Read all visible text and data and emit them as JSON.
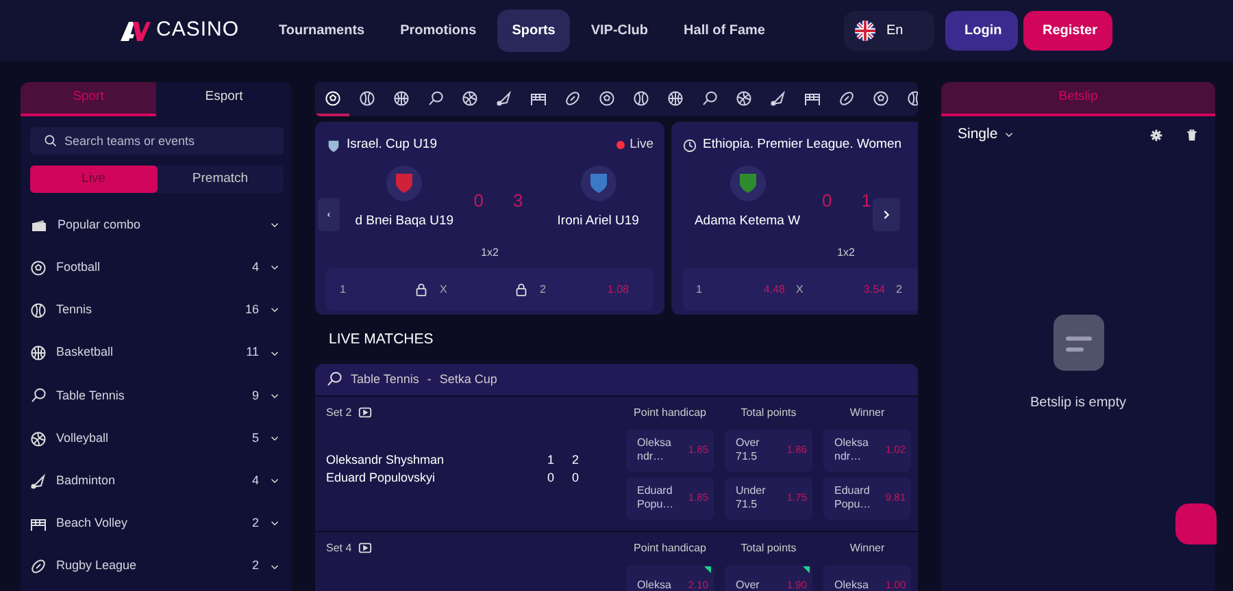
{
  "header": {
    "brand": "CASINO",
    "nav": [
      {
        "label": "Tournaments",
        "selected": false
      },
      {
        "label": "Promotions",
        "selected": false
      },
      {
        "label": "Sports",
        "selected": true
      },
      {
        "label": "VIP-Club",
        "selected": false
      },
      {
        "label": "Hall of Fame",
        "selected": false
      }
    ],
    "language": "En",
    "login": "Login",
    "register": "Register"
  },
  "sidebar": {
    "tabs": [
      {
        "label": "Sport",
        "selected": true
      },
      {
        "label": "Esport",
        "selected": false
      }
    ],
    "search": {
      "placeholder": "Search teams or events"
    },
    "modes": [
      {
        "label": "Live",
        "selected": true
      },
      {
        "label": "Prematch",
        "selected": false
      }
    ],
    "items": [
      {
        "name": "Popular combo"
      },
      {
        "name": "Football",
        "count": "4"
      },
      {
        "name": "Tennis",
        "count": "16"
      },
      {
        "name": "Basketball",
        "count": "11"
      },
      {
        "name": "Table Tennis",
        "count": "9"
      },
      {
        "name": "Volleyball",
        "count": "5"
      },
      {
        "name": "Badminton",
        "count": "4"
      },
      {
        "name": "Beach Volley",
        "count": "2"
      },
      {
        "name": "Rugby League",
        "count": "2"
      }
    ]
  },
  "sport_tabs": [
    {
      "selected": true
    },
    {
      "selected": false
    },
    {
      "selected": false
    },
    {
      "selected": false
    },
    {
      "selected": false
    },
    {
      "selected": false
    },
    {
      "selected": false
    },
    {
      "selected": false
    },
    {
      "selected": false
    },
    {
      "selected": false
    },
    {
      "selected": false
    },
    {
      "selected": false
    },
    {
      "selected": false
    },
    {
      "selected": false
    },
    {
      "selected": false
    },
    {
      "selected": false
    },
    {
      "selected": false
    },
    {
      "selected": false
    }
  ],
  "featured": [
    {
      "league": "Israel. Cup U19",
      "live": "Live",
      "team_1": "d Bnei Baqa U19",
      "team_2": "Ironi Ariel U19",
      "score_1": "0",
      "score_2": "3",
      "market": "1x2",
      "odds": [
        {
          "label": "1",
          "locked": true
        },
        {
          "label": "X",
          "locked": true
        },
        {
          "label": "2",
          "value": "1.08",
          "locked": false
        }
      ]
    },
    {
      "league": "Ethiopia. Premier League. Women",
      "team_1": "Adama Ketema W",
      "score_1": "0",
      "score_2": "1",
      "market": "1x2",
      "odds": [
        {
          "label": "1",
          "value": "4.48",
          "locked": false
        },
        {
          "label": "X",
          "value": "3.54",
          "locked": false
        },
        {
          "label": "2",
          "locked": false
        }
      ]
    }
  ],
  "live_matches": {
    "title": "LIVE MATCHES",
    "group": "Table Tennis",
    "separator": "-",
    "tournament": "Setka Cup",
    "matches": [
      {
        "period": "Set 2",
        "players": [
          "Oleksandr Shyshman",
          "Eduard Populovskyi"
        ],
        "scores": [
          [
            "1",
            "2"
          ],
          [
            "0",
            "0"
          ]
        ],
        "markets": [
          "Point handicap",
          "Total points",
          "Winner"
        ],
        "rows": [
          [
            {
              "label": "Oleksa ndr…",
              "value": "1.85",
              "rising": false
            },
            {
              "label": "Over 71.5",
              "value": "1.86",
              "rising": false
            },
            {
              "label": "Oleksa ndr…",
              "value": "1.02",
              "rising": false
            }
          ],
          [
            {
              "label": "Eduard Popu…",
              "value": "1.85",
              "rising": false
            },
            {
              "label": "Under 71.5",
              "value": "1.75",
              "rising": false
            },
            {
              "label": "Eduard Popu…",
              "value": "9.81",
              "rising": false
            }
          ]
        ]
      },
      {
        "period": "Set 4",
        "markets": [
          "Point handicap",
          "Total points",
          "Winner"
        ],
        "rows": [
          [
            {
              "label": "Oleksa",
              "value": "2.10",
              "rising": true
            },
            {
              "label": "Over",
              "value": "1.90",
              "rising": true
            },
            {
              "label": "Oleksa",
              "value": "1.00",
              "rising": false
            }
          ]
        ]
      }
    ]
  },
  "betslip": {
    "tab": {
      "label": "Betslip",
      "selected": true
    },
    "mode": "Single",
    "empty": "Betslip is empty"
  }
}
